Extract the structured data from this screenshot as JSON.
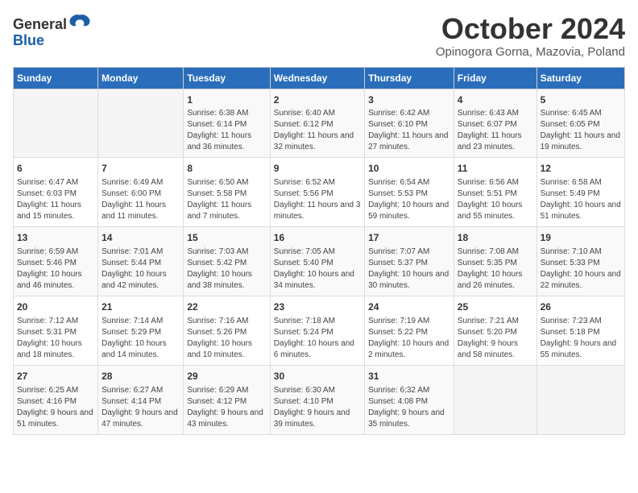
{
  "logo": {
    "general": "General",
    "blue": "Blue"
  },
  "title": "October 2024",
  "subtitle": "Opinogora Gorna, Mazovia, Poland",
  "days_of_week": [
    "Sunday",
    "Monday",
    "Tuesday",
    "Wednesday",
    "Thursday",
    "Friday",
    "Saturday"
  ],
  "weeks": [
    [
      {
        "day": "",
        "info": ""
      },
      {
        "day": "",
        "info": ""
      },
      {
        "day": "1",
        "info": "Sunrise: 6:38 AM\nSunset: 6:14 PM\nDaylight: 11 hours and 36 minutes."
      },
      {
        "day": "2",
        "info": "Sunrise: 6:40 AM\nSunset: 6:12 PM\nDaylight: 11 hours and 32 minutes."
      },
      {
        "day": "3",
        "info": "Sunrise: 6:42 AM\nSunset: 6:10 PM\nDaylight: 11 hours and 27 minutes."
      },
      {
        "day": "4",
        "info": "Sunrise: 6:43 AM\nSunset: 6:07 PM\nDaylight: 11 hours and 23 minutes."
      },
      {
        "day": "5",
        "info": "Sunrise: 6:45 AM\nSunset: 6:05 PM\nDaylight: 11 hours and 19 minutes."
      }
    ],
    [
      {
        "day": "6",
        "info": "Sunrise: 6:47 AM\nSunset: 6:03 PM\nDaylight: 11 hours and 15 minutes."
      },
      {
        "day": "7",
        "info": "Sunrise: 6:49 AM\nSunset: 6:00 PM\nDaylight: 11 hours and 11 minutes."
      },
      {
        "day": "8",
        "info": "Sunrise: 6:50 AM\nSunset: 5:58 PM\nDaylight: 11 hours and 7 minutes."
      },
      {
        "day": "9",
        "info": "Sunrise: 6:52 AM\nSunset: 5:56 PM\nDaylight: 11 hours and 3 minutes."
      },
      {
        "day": "10",
        "info": "Sunrise: 6:54 AM\nSunset: 5:53 PM\nDaylight: 10 hours and 59 minutes."
      },
      {
        "day": "11",
        "info": "Sunrise: 6:56 AM\nSunset: 5:51 PM\nDaylight: 10 hours and 55 minutes."
      },
      {
        "day": "12",
        "info": "Sunrise: 6:58 AM\nSunset: 5:49 PM\nDaylight: 10 hours and 51 minutes."
      }
    ],
    [
      {
        "day": "13",
        "info": "Sunrise: 6:59 AM\nSunset: 5:46 PM\nDaylight: 10 hours and 46 minutes."
      },
      {
        "day": "14",
        "info": "Sunrise: 7:01 AM\nSunset: 5:44 PM\nDaylight: 10 hours and 42 minutes."
      },
      {
        "day": "15",
        "info": "Sunrise: 7:03 AM\nSunset: 5:42 PM\nDaylight: 10 hours and 38 minutes."
      },
      {
        "day": "16",
        "info": "Sunrise: 7:05 AM\nSunset: 5:40 PM\nDaylight: 10 hours and 34 minutes."
      },
      {
        "day": "17",
        "info": "Sunrise: 7:07 AM\nSunset: 5:37 PM\nDaylight: 10 hours and 30 minutes."
      },
      {
        "day": "18",
        "info": "Sunrise: 7:08 AM\nSunset: 5:35 PM\nDaylight: 10 hours and 26 minutes."
      },
      {
        "day": "19",
        "info": "Sunrise: 7:10 AM\nSunset: 5:33 PM\nDaylight: 10 hours and 22 minutes."
      }
    ],
    [
      {
        "day": "20",
        "info": "Sunrise: 7:12 AM\nSunset: 5:31 PM\nDaylight: 10 hours and 18 minutes."
      },
      {
        "day": "21",
        "info": "Sunrise: 7:14 AM\nSunset: 5:29 PM\nDaylight: 10 hours and 14 minutes."
      },
      {
        "day": "22",
        "info": "Sunrise: 7:16 AM\nSunset: 5:26 PM\nDaylight: 10 hours and 10 minutes."
      },
      {
        "day": "23",
        "info": "Sunrise: 7:18 AM\nSunset: 5:24 PM\nDaylight: 10 hours and 6 minutes."
      },
      {
        "day": "24",
        "info": "Sunrise: 7:19 AM\nSunset: 5:22 PM\nDaylight: 10 hours and 2 minutes."
      },
      {
        "day": "25",
        "info": "Sunrise: 7:21 AM\nSunset: 5:20 PM\nDaylight: 9 hours and 58 minutes."
      },
      {
        "day": "26",
        "info": "Sunrise: 7:23 AM\nSunset: 5:18 PM\nDaylight: 9 hours and 55 minutes."
      }
    ],
    [
      {
        "day": "27",
        "info": "Sunrise: 6:25 AM\nSunset: 4:16 PM\nDaylight: 9 hours and 51 minutes."
      },
      {
        "day": "28",
        "info": "Sunrise: 6:27 AM\nSunset: 4:14 PM\nDaylight: 9 hours and 47 minutes."
      },
      {
        "day": "29",
        "info": "Sunrise: 6:29 AM\nSunset: 4:12 PM\nDaylight: 9 hours and 43 minutes."
      },
      {
        "day": "30",
        "info": "Sunrise: 6:30 AM\nSunset: 4:10 PM\nDaylight: 9 hours and 39 minutes."
      },
      {
        "day": "31",
        "info": "Sunrise: 6:32 AM\nSunset: 4:08 PM\nDaylight: 9 hours and 35 minutes."
      },
      {
        "day": "",
        "info": ""
      },
      {
        "day": "",
        "info": ""
      }
    ]
  ]
}
